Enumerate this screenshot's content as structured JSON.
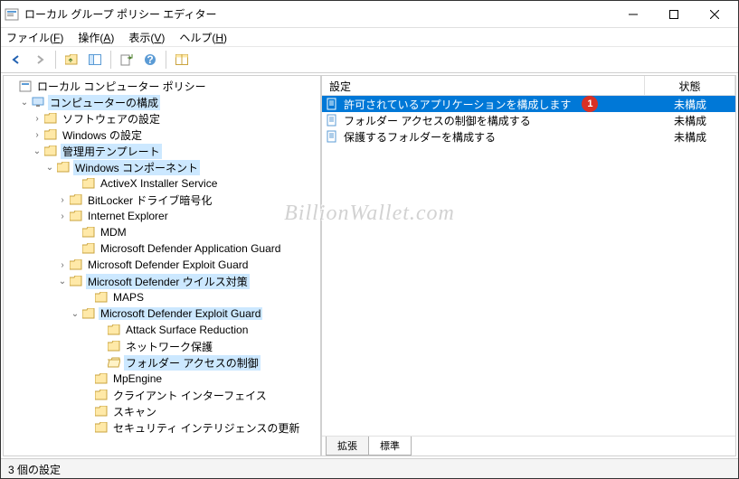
{
  "title": "ローカル グループ ポリシー エディター",
  "menu": {
    "file": "ファイル(F)",
    "action": "操作(A)",
    "view": "表示(V)",
    "help": "ヘルプ(H)"
  },
  "tree": {
    "root": "ローカル コンピューター ポリシー",
    "computer_config": "コンピューターの構成",
    "software_settings": "ソフトウェアの設定",
    "windows_settings": "Windows の設定",
    "admin_templates": "管理用テンプレート",
    "win_components": "Windows コンポーネント",
    "activex": "ActiveX Installer Service",
    "bitlocker": "BitLocker ドライブ暗号化",
    "ie": "Internet Explorer",
    "mdm": "MDM",
    "mdag": "Microsoft Defender Application Guard",
    "mdeg1": "Microsoft Defender Exploit Guard",
    "md_av": "Microsoft Defender ウイルス対策",
    "maps": "MAPS",
    "mdeg2": "Microsoft Defender Exploit Guard",
    "asr": "Attack Surface Reduction",
    "netprotect": "ネットワーク保護",
    "folder_access": "フォルダー アクセスの制御",
    "mpengine": "MpEngine",
    "client_ui": "クライアント インターフェイス",
    "scan": "スキャン",
    "sec_intel": "セキュリティ インテリジェンスの更新"
  },
  "list": {
    "header_setting": "設定",
    "header_state": "状態",
    "items": [
      {
        "text": "許可されているアプリケーションを構成します",
        "state": "未構成",
        "selected": true,
        "badge": "1"
      },
      {
        "text": "フォルダー アクセスの制御を構成する",
        "state": "未構成",
        "selected": false
      },
      {
        "text": "保護するフォルダーを構成する",
        "state": "未構成",
        "selected": false
      }
    ]
  },
  "tabs": {
    "extended": "拡張",
    "standard": "標準"
  },
  "status": "3 個の設定",
  "watermark": "BillionWallet.com"
}
